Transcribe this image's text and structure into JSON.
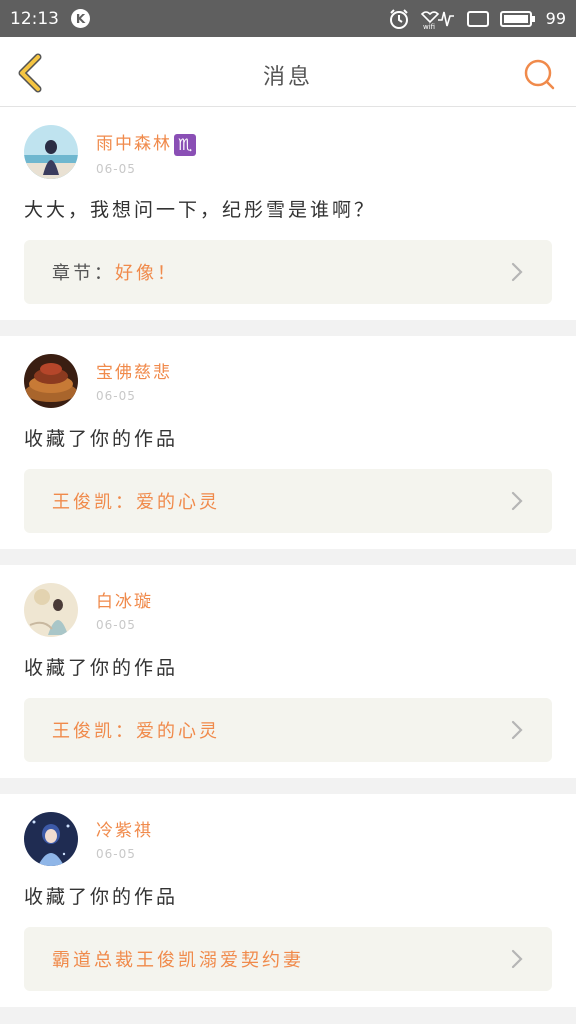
{
  "status_bar": {
    "time": "12:13",
    "app_badge": "K",
    "battery": "99"
  },
  "header": {
    "title": "消息"
  },
  "messages": [
    {
      "username": "雨中森林",
      "zodiac": "♏",
      "date": "06-05",
      "text": "大大，我想问一下，纪彤雪是谁啊？",
      "link_label": "章节：",
      "link_title": "好像！"
    },
    {
      "username": "宝佛慈悲",
      "date": "06-05",
      "text": "收藏了你的作品",
      "link_title": "王俊凯：爱的心灵"
    },
    {
      "username": "白冰璇",
      "date": "06-05",
      "text": "收藏了你的作品",
      "link_title": "王俊凯：爱的心灵"
    },
    {
      "username": "冷紫祺",
      "date": "06-05",
      "text": "收藏了你的作品",
      "link_title": "霸道总裁王俊凯溺爱契约妻"
    }
  ],
  "colors": {
    "accent": "#f08a4b",
    "back_arrow": "#f5c542",
    "status_bar_bg": "#5f5f5f",
    "link_box_bg": "#f4f4ee"
  },
  "icons": {
    "back": "chevron-left-icon",
    "search": "search-icon",
    "alarm": "alarm-icon",
    "wifi": "wifi-icon",
    "battery": "battery-icon",
    "link_arrow": "chevron-right-icon"
  }
}
